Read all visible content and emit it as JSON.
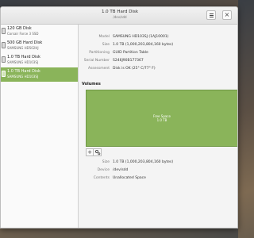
{
  "window": {
    "title": "1.0 TB Hard Disk",
    "subtitle": "/dev/sdd",
    "menu_icon": "hamburger-icon",
    "close_label": "×"
  },
  "sidebar": {
    "items": [
      {
        "name": "120 GB Disk",
        "sub": "Corsair Force 3 SSD",
        "selected": false
      },
      {
        "name": "500 GB Hard Disk",
        "sub": "SAMSUNG HD502HJ",
        "selected": false
      },
      {
        "name": "1.0 TB Hard Disk",
        "sub": "SAMSUNG HD103SJ",
        "selected": false
      },
      {
        "name": "1.0 TB Hard Disk",
        "sub": "SAMSUNG HD103SJ",
        "selected": true
      }
    ]
  },
  "disk": {
    "model_label": "Model",
    "model": "SAMSUNG HD103SJ (1AJ10001)",
    "size_label": "Size",
    "size": "1.0 TB (1,000,203,804,160 bytes)",
    "partitioning_label": "Partitioning",
    "partitioning": "GUID Partition Table",
    "serial_label": "Serial Number",
    "serial": "S246J90B177367",
    "assessment_label": "Assessment",
    "assessment": "Disk is OK (25° C/77° F)"
  },
  "volumes": {
    "heading": "Volumes",
    "segment_label": "Free Space",
    "segment_size": "1.0 TB",
    "add_label": "+",
    "settings_icon": "gears-icon"
  },
  "selected_volume": {
    "size_label": "Size",
    "size": "1.0 TB (1,000,203,804,160 bytes)",
    "device_label": "Device",
    "device": "/dev/sdd",
    "contents_label": "Contents",
    "contents": "Unallocated Space"
  },
  "colors": {
    "accent": "#8ab45a"
  }
}
